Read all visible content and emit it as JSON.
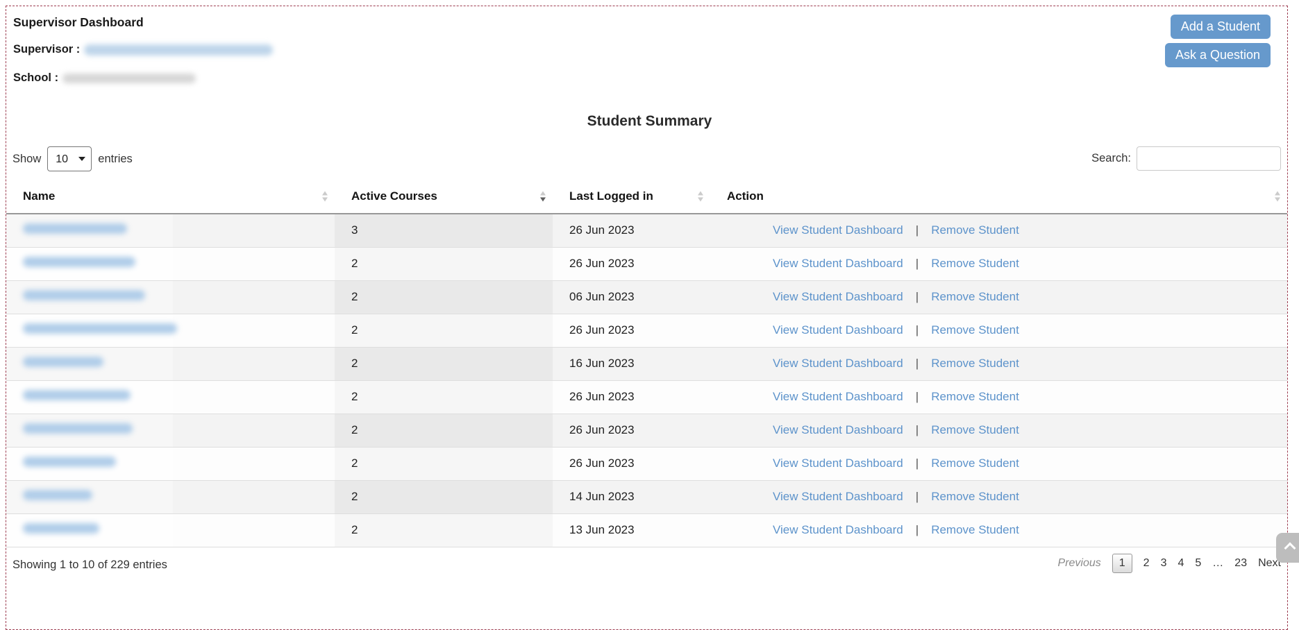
{
  "page": {
    "title": "Supervisor Dashboard",
    "supervisor_label": "Supervisor :",
    "school_label": "School :",
    "supervisor_value_redacted": true,
    "school_value_redacted": true
  },
  "buttons": {
    "add_student": "Add a Student",
    "ask_question": "Ask a Question"
  },
  "summary": {
    "heading": "Student Summary"
  },
  "controls": {
    "show_label": "Show",
    "page_size": "10",
    "entries_label": "entries",
    "search_label": "Search:",
    "search_value": ""
  },
  "table": {
    "columns": [
      "Name",
      "Active Courses",
      "Last Logged in",
      "Action"
    ],
    "sorted_column": "Active Courses",
    "sort_direction": "desc",
    "action_links": {
      "view": "View Student Dashboard",
      "separator": "|",
      "remove": "Remove Student"
    },
    "rows": [
      {
        "name_redacted": true,
        "name_blob_width": 150,
        "active_courses": "3",
        "last_logged_in": "26 Jun 2023"
      },
      {
        "name_redacted": true,
        "name_blob_width": 162,
        "active_courses": "2",
        "last_logged_in": "26 Jun 2023"
      },
      {
        "name_redacted": true,
        "name_blob_width": 176,
        "active_courses": "2",
        "last_logged_in": "06 Jun 2023"
      },
      {
        "name_redacted": true,
        "name_blob_width": 222,
        "active_courses": "2",
        "last_logged_in": "26 Jun 2023"
      },
      {
        "name_redacted": true,
        "name_blob_width": 116,
        "active_courses": "2",
        "last_logged_in": "16 Jun 2023"
      },
      {
        "name_redacted": true,
        "name_blob_width": 155,
        "active_courses": "2",
        "last_logged_in": "26 Jun 2023"
      },
      {
        "name_redacted": true,
        "name_blob_width": 158,
        "active_courses": "2",
        "last_logged_in": "26 Jun 2023"
      },
      {
        "name_redacted": true,
        "name_blob_width": 134,
        "active_courses": "2",
        "last_logged_in": "26 Jun 2023"
      },
      {
        "name_redacted": true,
        "name_blob_width": 100,
        "active_courses": "2",
        "last_logged_in": "14 Jun 2023"
      },
      {
        "name_redacted": true,
        "name_blob_width": 110,
        "active_courses": "2",
        "last_logged_in": "13 Jun 2023"
      }
    ]
  },
  "footer": {
    "info": "Showing 1 to 10 of 229 entries",
    "pagination": {
      "previous": "Previous",
      "pages": [
        "1",
        "2",
        "3",
        "4",
        "5"
      ],
      "current_page": "1",
      "ellipsis": "…",
      "last_page": "23",
      "next": "Next"
    }
  },
  "icons": {
    "scroll_top": "chevron-up-icon"
  },
  "colors": {
    "button_bg": "#6699cc",
    "link": "#5d93cb",
    "frame_border": "#9d3c50",
    "row_stripe": "#f3f3f3",
    "sorted_cell_stripe": "#e9e9e9",
    "scroll_top_bg": "#bdbdbd"
  }
}
